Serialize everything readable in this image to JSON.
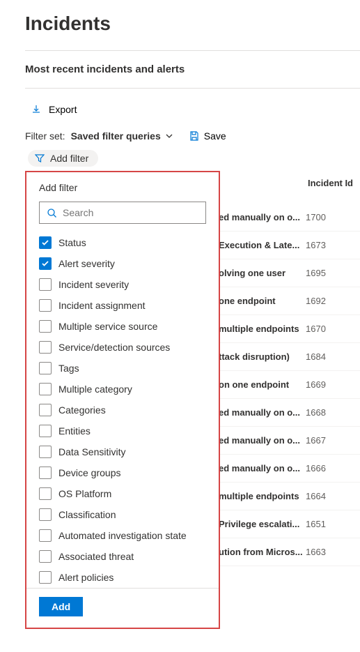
{
  "page_title": "Incidents",
  "subtitle": "Most recent incidents and alerts",
  "toolbar": {
    "export": "Export"
  },
  "filterset": {
    "label": "Filter set:",
    "selected": "Saved filter queries",
    "save": "Save"
  },
  "addfilter_chip": "Add filter",
  "popover": {
    "title": "Add filter",
    "search_placeholder": "Search",
    "filters": [
      {
        "label": "Status",
        "checked": true
      },
      {
        "label": "Alert severity",
        "checked": true
      },
      {
        "label": "Incident severity",
        "checked": false
      },
      {
        "label": "Incident assignment",
        "checked": false
      },
      {
        "label": "Multiple service source",
        "checked": false
      },
      {
        "label": "Service/detection sources",
        "checked": false
      },
      {
        "label": "Tags",
        "checked": false
      },
      {
        "label": "Multiple category",
        "checked": false
      },
      {
        "label": "Categories",
        "checked": false
      },
      {
        "label": "Entities",
        "checked": false
      },
      {
        "label": "Data Sensitivity",
        "checked": false
      },
      {
        "label": "Device groups",
        "checked": false
      },
      {
        "label": "OS Platform",
        "checked": false
      },
      {
        "label": "Classification",
        "checked": false
      },
      {
        "label": "Automated investigation state",
        "checked": false
      },
      {
        "label": "Associated threat",
        "checked": false
      },
      {
        "label": "Alert policies",
        "checked": false
      }
    ],
    "add_button": "Add"
  },
  "table": {
    "id_header": "Incident Id",
    "rows": [
      {
        "name": "ed manually on o...",
        "id": "1700"
      },
      {
        "name": "Execution & Late...",
        "id": "1673"
      },
      {
        "name": "olving one user",
        "id": "1695"
      },
      {
        "name": "one endpoint",
        "id": "1692"
      },
      {
        "name": "multiple endpoints",
        "id": "1670"
      },
      {
        "name": "ttack disruption)",
        "id": "1684"
      },
      {
        "name": "on one endpoint",
        "id": "1669"
      },
      {
        "name": "ed manually on o...",
        "id": "1668"
      },
      {
        "name": "ed manually on o...",
        "id": "1667"
      },
      {
        "name": "ed manually on o...",
        "id": "1666"
      },
      {
        "name": "multiple endpoints",
        "id": "1664"
      },
      {
        "name": "Privilege escalati...",
        "id": "1651"
      },
      {
        "name": "ution from Micros...",
        "id": "1663"
      }
    ]
  }
}
